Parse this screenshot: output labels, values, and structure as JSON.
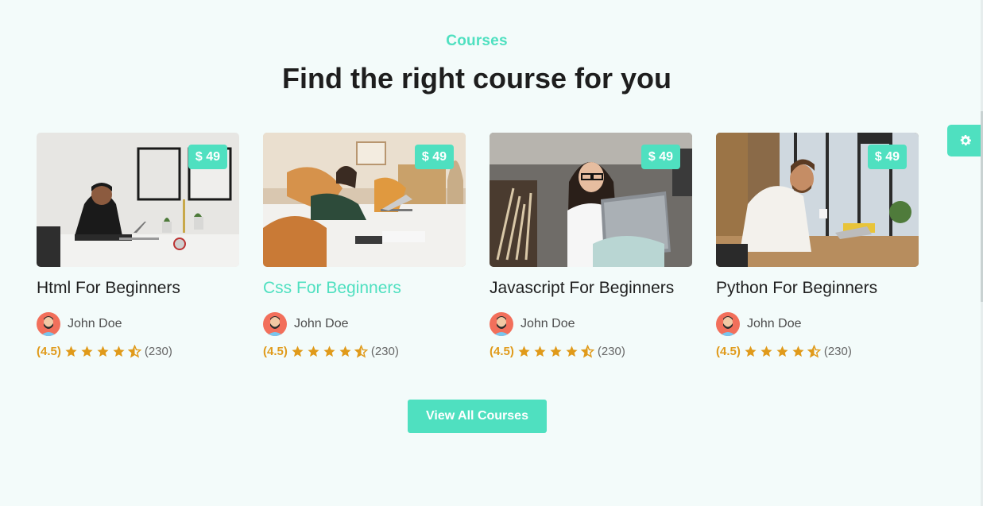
{
  "section": {
    "eyebrow": "Courses",
    "heading": "Find the right course for you",
    "cta_label": "View All Courses"
  },
  "colors": {
    "accent": "#4fe0c0",
    "rating": "#e09a1a",
    "background": "#f3fbfa"
  },
  "courses": [
    {
      "title": "Html For Beginners",
      "price": "$ 49",
      "author": "John Doe",
      "score": "(4.5)",
      "rating_value": 4.5,
      "reviews": "(230)",
      "highlighted": false,
      "image": "man-at-laptop-white-desk"
    },
    {
      "title": "Css For Beginners",
      "price": "$ 49",
      "author": "John Doe",
      "score": "(4.5)",
      "rating_value": 4.5,
      "reviews": "(230)",
      "highlighted": true,
      "image": "woman-on-bed-with-laptop"
    },
    {
      "title": "Javascript For Beginners",
      "price": "$ 49",
      "author": "John Doe",
      "score": "(4.5)",
      "rating_value": 4.5,
      "reviews": "(230)",
      "highlighted": false,
      "image": "smiling-woman-at-laptop"
    },
    {
      "title": "Python For Beginners",
      "price": "$ 49",
      "author": "John Doe",
      "score": "(4.5)",
      "rating_value": 4.5,
      "reviews": "(230)",
      "highlighted": false,
      "image": "man-with-coffee-at-laptop"
    }
  ],
  "settings_icon": "gear-icon"
}
